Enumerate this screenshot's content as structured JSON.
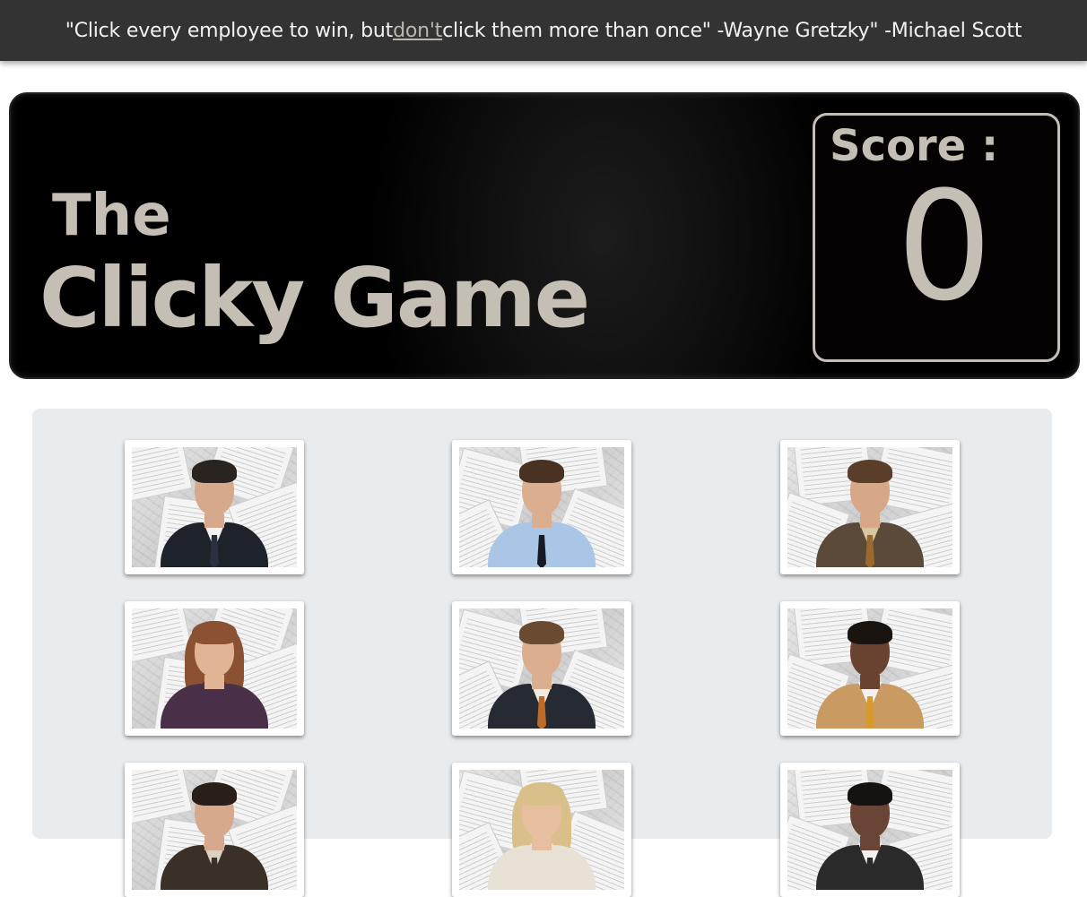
{
  "banner": {
    "quote_before": "\"Click every employee to win, but ",
    "quote_link": "don't",
    "quote_after": " click them more than once\" -Wayne Gretzky\" -Michael Scott"
  },
  "hero": {
    "line1": "The",
    "line2": "Clicky Game"
  },
  "score": {
    "label": "Score :",
    "value": "0"
  },
  "colors": {
    "topbar_bg": "#333333",
    "accent_text": "#c5beb4",
    "board_bg": "#e9ecef"
  },
  "cards": [
    {
      "name": "employee-card-1",
      "suit": "#1e232b",
      "shirt": "#f2f2f2",
      "tie": "#2b3040",
      "hair": "#2a2420",
      "skin": "#d7a98c"
    },
    {
      "name": "employee-card-2",
      "suit": "#a9c6e6",
      "shirt": "#a9c6e6",
      "tie": "#171a24",
      "hair": "#4a3222",
      "skin": "#dcae90"
    },
    {
      "name": "employee-card-3",
      "suit": "#5b4a3a",
      "shirt": "#d9c7a0",
      "tie": "#9a6a2c",
      "hair": "#5a3e2a",
      "skin": "#d6a888"
    },
    {
      "name": "employee-card-4",
      "suit": "#4a2f48",
      "shirt": "#4a2f48",
      "tie": "#4a2f48",
      "hair": "#8a5232",
      "skin": "#e2b496",
      "long": true
    },
    {
      "name": "employee-card-5",
      "suit": "#252a33",
      "shirt": "#f0ece0",
      "tie": "#c06a2a",
      "hair": "#6a4a30",
      "skin": "#dcae90"
    },
    {
      "name": "employee-card-6",
      "suit": "#c99a62",
      "shirt": "#f2f2f2",
      "tie": "#d89a2a",
      "hair": "#1a1410",
      "skin": "#6a4330"
    },
    {
      "name": "employee-card-7",
      "suit": "#3a3028",
      "shirt": "#d9d2c4",
      "tie": "#3a3028",
      "hair": "#2a1e18",
      "skin": "#d7a98c"
    },
    {
      "name": "employee-card-8",
      "suit": "#e8e2d6",
      "shirt": "#e8e2d6",
      "tie": "#e8e2d6",
      "hair": "#d9c08a",
      "skin": "#e8bea0",
      "long": true
    },
    {
      "name": "employee-card-9",
      "suit": "#2a2a2a",
      "shirt": "#f0f0f0",
      "tie": "#2a2a2a",
      "hair": "#161210",
      "skin": "#6a4535"
    }
  ]
}
